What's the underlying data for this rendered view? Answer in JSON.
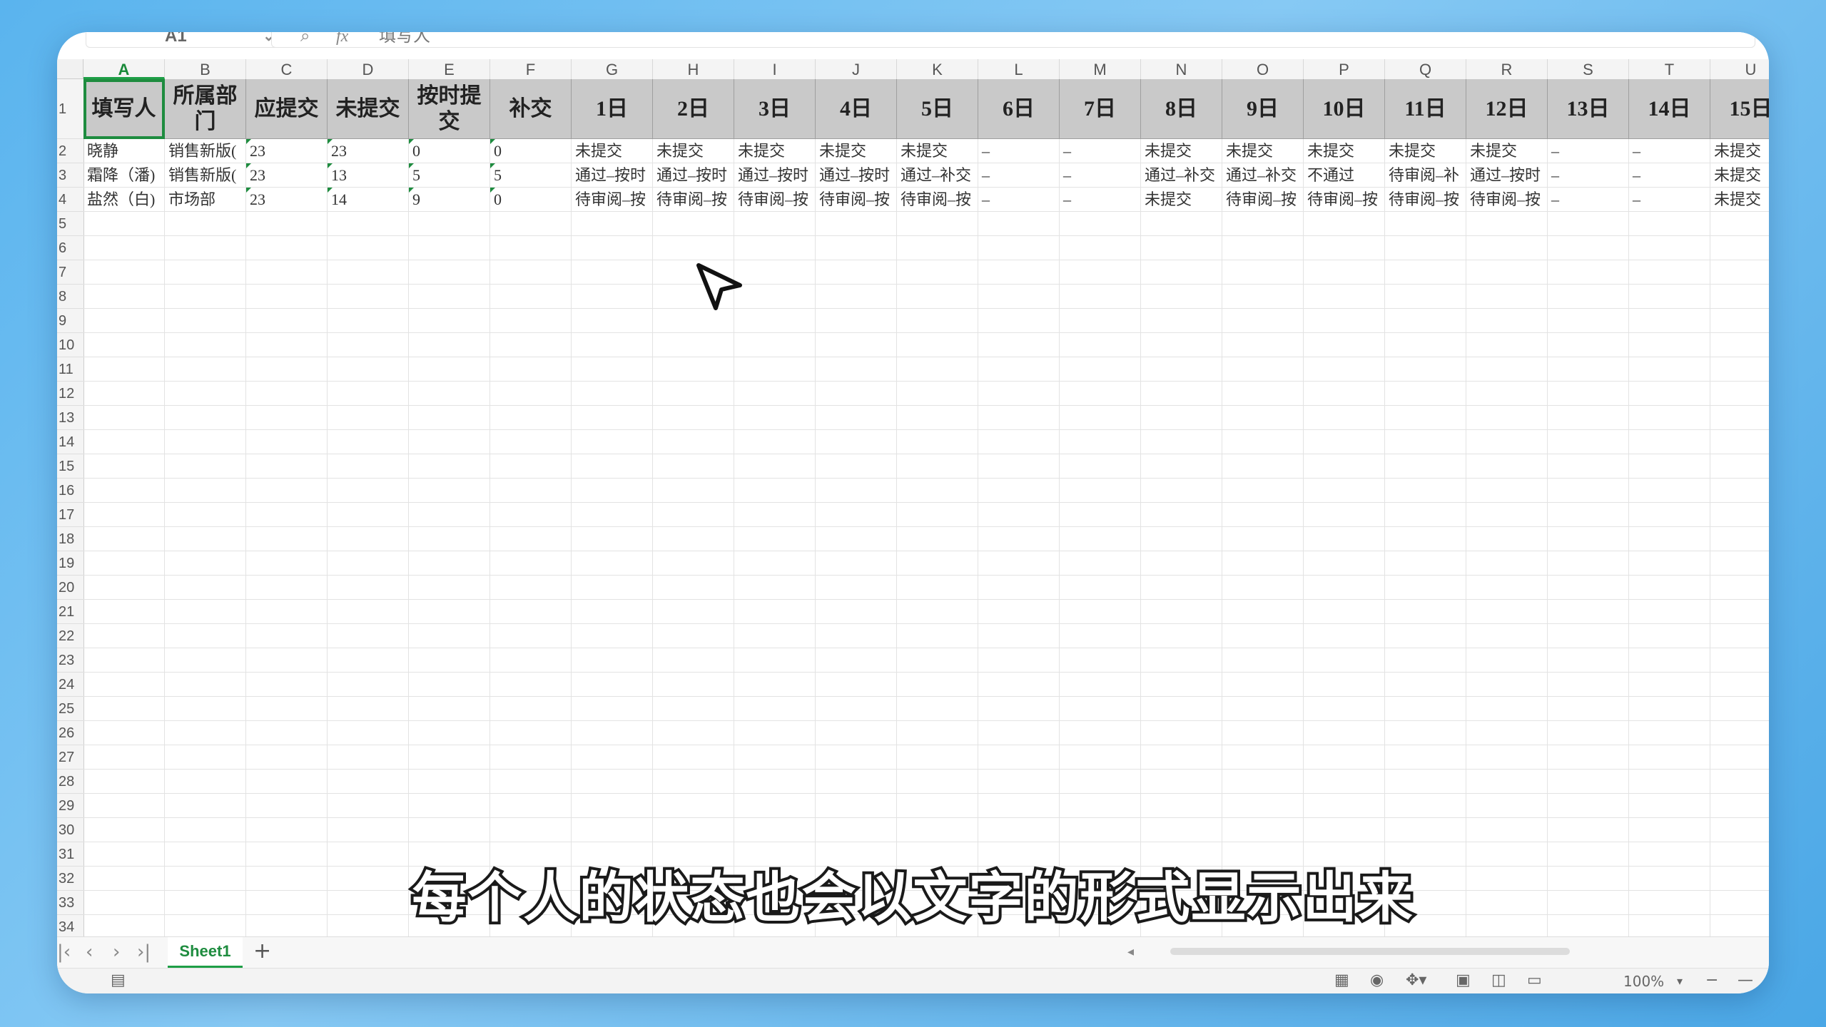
{
  "formula_bar": {
    "cell_ref": "A1",
    "fx": "fx",
    "content": "填写人"
  },
  "columns": [
    "A",
    "B",
    "C",
    "D",
    "E",
    "F",
    "G",
    "H",
    "I",
    "J",
    "K",
    "L",
    "M",
    "N",
    "O",
    "P",
    "Q",
    "R",
    "S",
    "T",
    "U"
  ],
  "row_numbers": [
    "1",
    "2",
    "3",
    "4",
    "5",
    "6",
    "7",
    "8",
    "9",
    "10",
    "11",
    "12",
    "13",
    "14",
    "15",
    "16",
    "17",
    "18",
    "19",
    "20",
    "21",
    "22",
    "23",
    "24",
    "25",
    "26",
    "27",
    "28",
    "29",
    "30",
    "31",
    "32",
    "33",
    "34"
  ],
  "header_row": [
    "填写人",
    "所属部\n门",
    "应提交",
    "未提交",
    "按时提\n交",
    "补交",
    "1日",
    "2日",
    "3日",
    "4日",
    "5日",
    "6日",
    "7日",
    "8日",
    "9日",
    "10日",
    "11日",
    "12日",
    "13日",
    "14日",
    "15日"
  ],
  "data_rows": [
    [
      "晓静",
      "销售新版(",
      "23",
      "23",
      "0",
      "0",
      "未提交",
      "未提交",
      "未提交",
      "未提交",
      "未提交",
      "–",
      "–",
      "未提交",
      "未提交",
      "未提交",
      "未提交",
      "未提交",
      "–",
      "–",
      "未提交"
    ],
    [
      "霜降（潘)",
      "销售新版(",
      "23",
      "13",
      "5",
      "5",
      "通过–按时",
      "通过–按时",
      "通过–按时",
      "通过–按时",
      "通过–补交",
      "–",
      "–",
      "通过–补交",
      "通过–补交",
      "不通过",
      "待审阅–补",
      "通过–按时",
      "–",
      "–",
      "未提交"
    ],
    [
      "盐然（白)",
      "市场部",
      "23",
      "14",
      "9",
      "0",
      "待审阅–按",
      "待审阅–按",
      "待审阅–按",
      "待审阅–按",
      "待审阅–按",
      "–",
      "–",
      "未提交",
      "待审阅–按",
      "待审阅–按",
      "待审阅–按",
      "待审阅–按",
      "–",
      "–",
      "未提交"
    ]
  ],
  "sheet_tab": "Sheet1",
  "add_sheet": "+",
  "zoom": "100%",
  "subtitle": "每个人的状态也会以文字的形式显示出来"
}
